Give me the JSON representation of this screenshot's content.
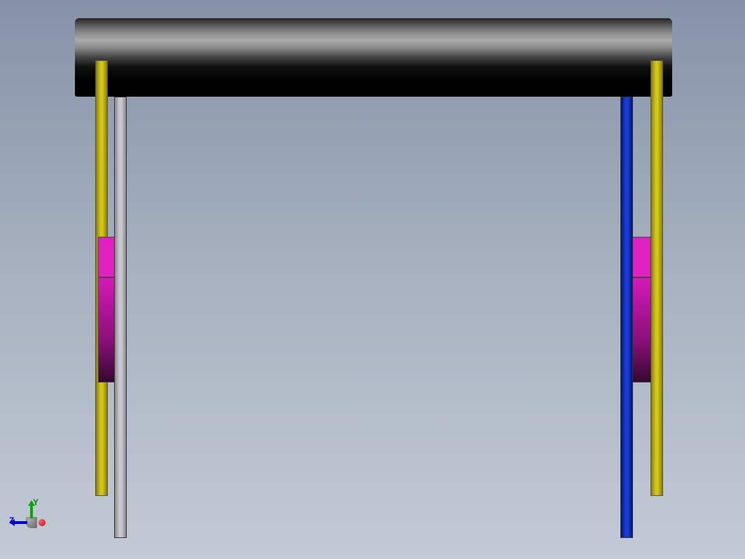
{
  "viewport": {
    "axes": {
      "y_label": "Y",
      "z_label": "Z"
    }
  },
  "model": {
    "parts": {
      "top_bar": "top-cylinder",
      "left_yellow": "yellow-rod-left",
      "right_yellow": "yellow-rod-right",
      "left_gray": "gray-rod-left",
      "right_blue": "blue-rod-right",
      "left_magenta_upper": "magenta-block-left-upper",
      "left_magenta_lower": "magenta-block-left-lower",
      "right_magenta_upper": "magenta-block-right-upper",
      "right_magenta_lower": "magenta-block-right-lower"
    },
    "colors": {
      "top_bar": "#000000",
      "yellow": "#cfc616",
      "gray": "#c8c8d0",
      "blue": "#1a3adf",
      "magenta": "#e020c0"
    }
  }
}
